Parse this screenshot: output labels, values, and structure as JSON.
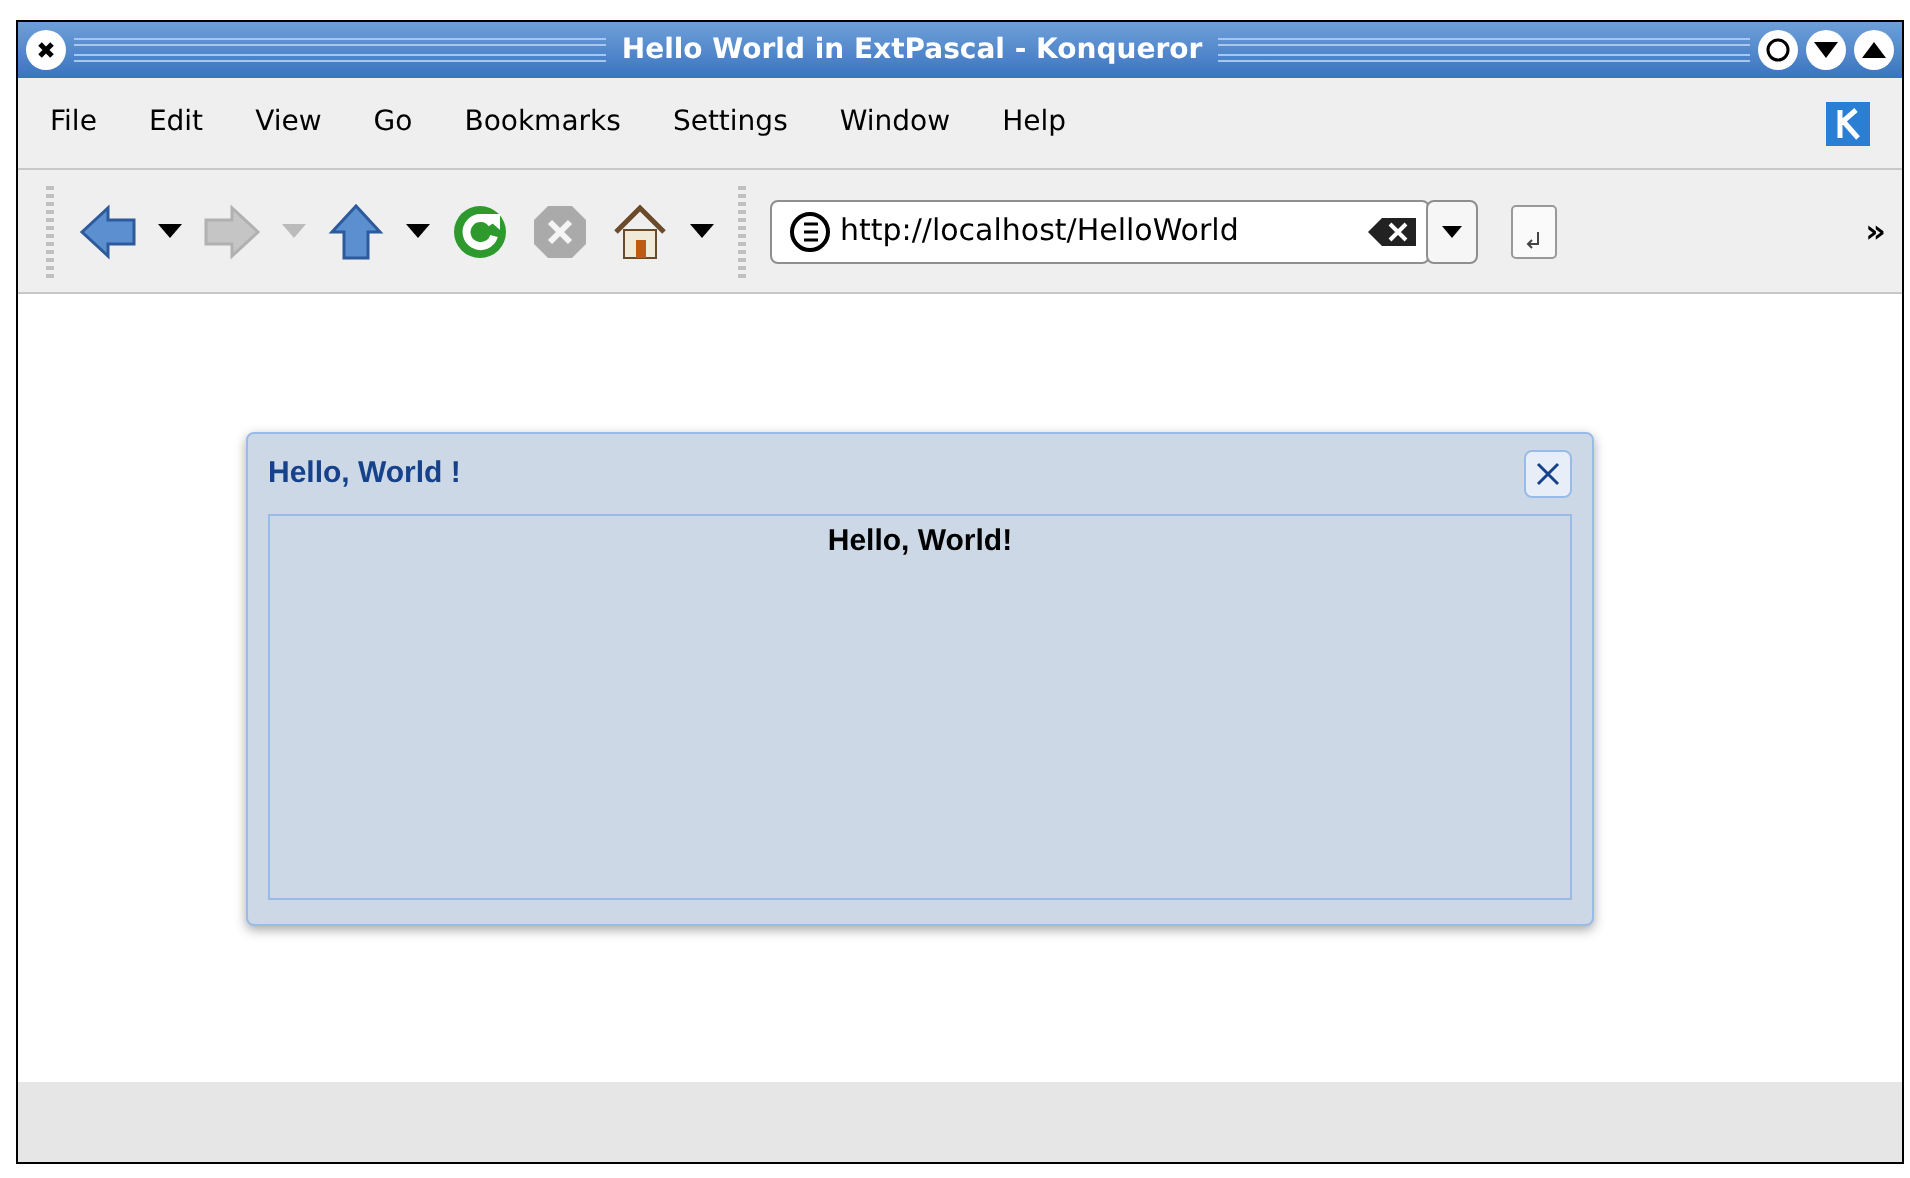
{
  "window": {
    "title": "Hello World in ExtPascal - Konqueror"
  },
  "menu": [
    "File",
    "Edit",
    "View",
    "Go",
    "Bookmarks",
    "Settings",
    "Window",
    "Help"
  ],
  "toolbar": [
    {
      "kind": "back",
      "disabled": false
    },
    {
      "kind": "forward",
      "disabled": true
    },
    {
      "kind": "up",
      "disabled": false
    },
    {
      "kind": "reload",
      "disabled": false
    },
    {
      "kind": "stop",
      "disabled": true
    },
    {
      "kind": "home",
      "disabled": false
    }
  ],
  "location": {
    "value": "http://localhost/HelloWorld"
  },
  "overflow": "»",
  "dialog": {
    "title": "Hello, World !",
    "body": "Hello, World!"
  }
}
